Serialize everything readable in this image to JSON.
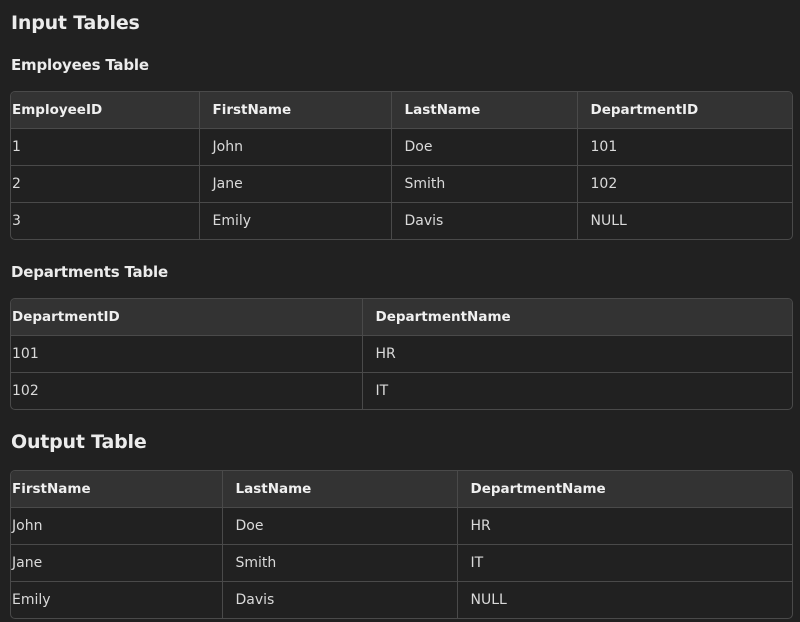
{
  "input_section": {
    "title": "Input Tables",
    "employees": {
      "title": "Employees Table",
      "headers": [
        "EmployeeID",
        "FirstName",
        "LastName",
        "DepartmentID"
      ],
      "rows": [
        [
          "1",
          "John",
          "Doe",
          "101"
        ],
        [
          "2",
          "Jane",
          "Smith",
          "102"
        ],
        [
          "3",
          "Emily",
          "Davis",
          "NULL"
        ]
      ]
    },
    "departments": {
      "title": "Departments Table",
      "headers": [
        "DepartmentID",
        "DepartmentName"
      ],
      "rows": [
        [
          "101",
          "HR"
        ],
        [
          "102",
          "IT"
        ]
      ]
    }
  },
  "output_section": {
    "title": "Output Table",
    "headers": [
      "FirstName",
      "LastName",
      "DepartmentName"
    ],
    "rows": [
      [
        "John",
        "Doe",
        "HR"
      ],
      [
        "Jane",
        "Smith",
        "IT"
      ],
      [
        "Emily",
        "Davis",
        "NULL"
      ]
    ]
  }
}
